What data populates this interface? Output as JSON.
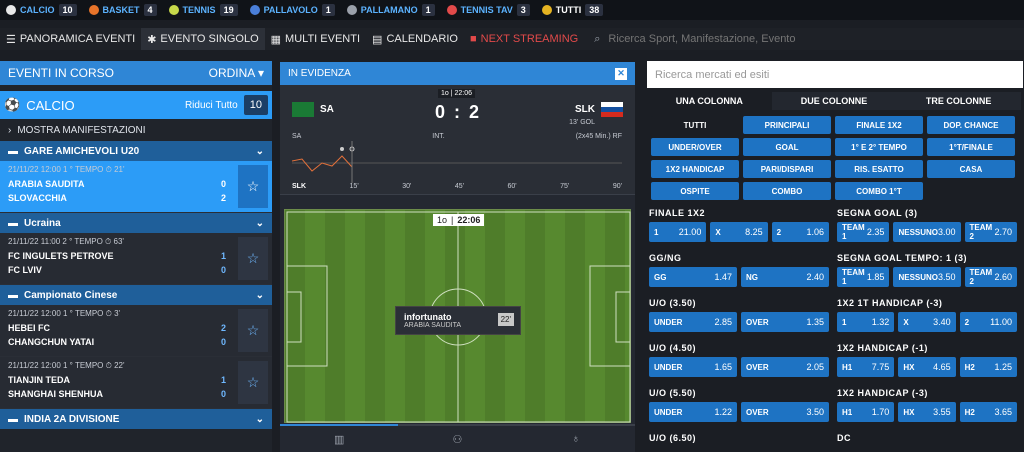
{
  "sports": [
    {
      "name": "CALCIO",
      "count": "10",
      "color": "#e8e8e8"
    },
    {
      "name": "BASKET",
      "count": "4",
      "color": "#e8742a"
    },
    {
      "name": "TENNIS",
      "count": "19",
      "color": "#c7d94a"
    },
    {
      "name": "PALLAVOLO",
      "count": "1",
      "color": "#4a7fd9"
    },
    {
      "name": "PALLAMANO",
      "count": "1",
      "color": "#9aa0aa"
    },
    {
      "name": "TENNIS TAV",
      "count": "3",
      "color": "#e24a4a"
    },
    {
      "name": "TUTTI",
      "count": "38",
      "color": "#e6b422"
    }
  ],
  "nav": {
    "items": [
      "PANORAMICA EVENTI",
      "EVENTO SINGOLO",
      "MULTI EVENTI",
      "CALENDARIO",
      "NEXT STREAMING"
    ],
    "search_placeholder": "Ricerca Sport, Manifestazione, Evento"
  },
  "left": {
    "title": "EVENTI IN CORSO",
    "order": "ORDINA",
    "sport": "CALCIO",
    "reduce": "Riduci Tutto",
    "count": "10",
    "show": "MOSTRA MANIFESTAZIONI",
    "leagues": [
      {
        "name": "GARE AMICHEVOLI U20",
        "matches": [
          {
            "date": "21/11/22 12:00 1 ° TEMPO ⏱ 21'",
            "home": "ARABIA SAUDITA",
            "hs": "0",
            "away": "SLOVACCHIA",
            "as": "2",
            "sel": true
          }
        ]
      },
      {
        "name": "Ucraina",
        "matches": [
          {
            "date": "21/11/22 11:00 2 ° TEMPO ⏱ 63'",
            "home": "FC INGULETS PETROVE",
            "hs": "1",
            "away": "FC LVIV",
            "as": "0",
            "sel": false
          }
        ]
      },
      {
        "name": "Campionato Cinese",
        "matches": [
          {
            "date": "21/11/22 12:00 1 ° TEMPO ⏱ 3'",
            "home": "HEBEI FC",
            "hs": "2",
            "away": "CHANGCHUN YATAI",
            "as": "0",
            "sel": false
          },
          {
            "date": "21/11/22 12:00 1 ° TEMPO ⏱ 22'",
            "home": "TIANJIN TEDA",
            "hs": "1",
            "away": "SHANGHAI SHENHUA",
            "as": "0",
            "sel": false
          }
        ]
      },
      {
        "name": "INDIA 2A DIVISIONE",
        "matches": []
      }
    ]
  },
  "center": {
    "title": "IN EVIDENZA",
    "period": "1o | 22:06",
    "home": "SA",
    "away": "SLK",
    "score": "0 : 2",
    "goal": "13' GOL",
    "tl_home": "SA",
    "tl_away": "SLK",
    "int": "INT.",
    "format": "(2x45 Min.) RF",
    "ticks": [
      "15'",
      "30'",
      "45'",
      "60'",
      "75'",
      "90'"
    ],
    "pitch_period": "1o",
    "pitch_time": "22:06",
    "event_title": "infortunato",
    "event_team": "ARABIA SAUDITA",
    "event_min": "22'"
  },
  "right": {
    "search_placeholder": "Ricerca mercati ed esiti",
    "columns": [
      "UNA COLONNA",
      "DUE COLONNE",
      "TRE COLONNE"
    ],
    "filters": [
      "TUTTI",
      "PRINCIPALI",
      "FINALE 1X2",
      "DOP. CHANCE",
      "UNDER/OVER",
      "GOAL",
      "1° E 2° TEMPO",
      "1°T/FINALE",
      "1X2 HANDICAP",
      "PARI/DISPARI",
      "RIS. ESATTO",
      "CASA",
      "OSPITE",
      "COMBO",
      "COMBO 1°T"
    ],
    "markets_left": [
      {
        "title": "FINALE 1X2",
        "odds": [
          [
            "1",
            "21.00"
          ],
          [
            "X",
            "8.25"
          ],
          [
            "2",
            "1.06"
          ]
        ]
      },
      {
        "title": "GG/NG",
        "odds": [
          [
            "GG",
            "1.47"
          ],
          [
            "NG",
            "2.40"
          ]
        ]
      },
      {
        "title": "U/O (3.50)",
        "odds": [
          [
            "UNDER",
            "2.85"
          ],
          [
            "OVER",
            "1.35"
          ]
        ]
      },
      {
        "title": "U/O (4.50)",
        "odds": [
          [
            "UNDER",
            "1.65"
          ],
          [
            "OVER",
            "2.05"
          ]
        ]
      },
      {
        "title": "U/O (5.50)",
        "odds": [
          [
            "UNDER",
            "1.22"
          ],
          [
            "OVER",
            "3.50"
          ]
        ]
      },
      {
        "title": "U/O (6.50)",
        "odds": []
      }
    ],
    "markets_right": [
      {
        "title": "SEGNA GOAL (3)",
        "odds": [
          [
            "TEAM 1",
            "2.35"
          ],
          [
            "NESSUNO",
            "3.00"
          ],
          [
            "TEAM 2",
            "2.70"
          ]
        ]
      },
      {
        "title": "SEGNA GOAL TEMPO: 1 (3)",
        "odds": [
          [
            "TEAM 1",
            "1.85"
          ],
          [
            "NESSUNO",
            "3.50"
          ],
          [
            "TEAM 2",
            "2.60"
          ]
        ]
      },
      {
        "title": "1X2 1T HANDICAP (-3)",
        "odds": [
          [
            "1",
            "1.32"
          ],
          [
            "X",
            "3.40"
          ],
          [
            "2",
            "11.00"
          ]
        ]
      },
      {
        "title": "1X2 HANDICAP (-1)",
        "odds": [
          [
            "H1",
            "7.75"
          ],
          [
            "HX",
            "4.65"
          ],
          [
            "H2",
            "1.25"
          ]
        ]
      },
      {
        "title": "1X2 HANDICAP (-3)",
        "odds": [
          [
            "H1",
            "1.70"
          ],
          [
            "HX",
            "3.55"
          ],
          [
            "H2",
            "3.65"
          ]
        ]
      },
      {
        "title": "DC",
        "odds": []
      }
    ]
  }
}
